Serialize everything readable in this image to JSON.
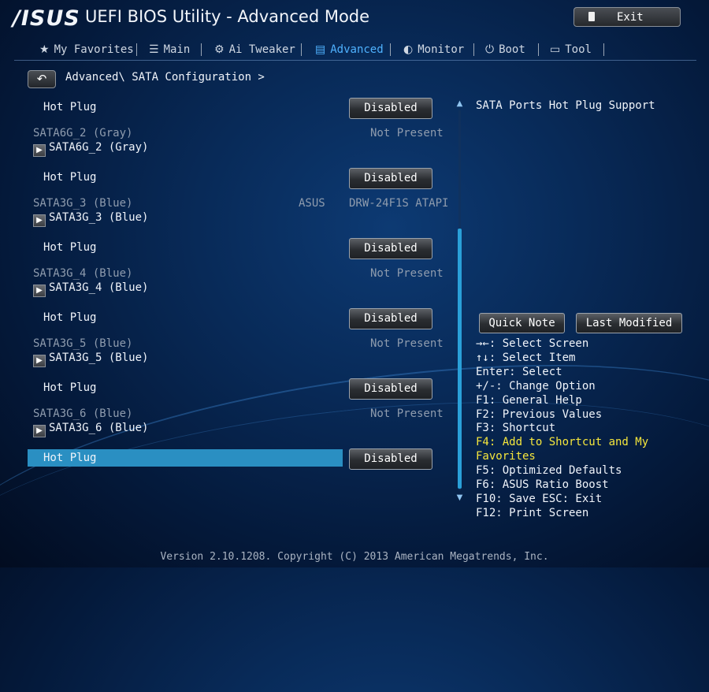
{
  "header": {
    "logo": "/ISUS",
    "title": "UEFI BIOS Utility - Advanced Mode",
    "exit_label": "Exit"
  },
  "nav": [
    {
      "label": "My Favorites",
      "icon": "star-icon"
    },
    {
      "label": "Main",
      "icon": "list-icon"
    },
    {
      "label": "Ai Tweaker",
      "icon": "tweaker-icon"
    },
    {
      "label": "Advanced",
      "icon": "advanced-icon",
      "active": true
    },
    {
      "label": "Monitor",
      "icon": "monitor-icon"
    },
    {
      "label": "Boot",
      "icon": "power-icon"
    },
    {
      "label": "Tool",
      "icon": "printer-icon"
    }
  ],
  "breadcrumb": "Advanced\\ SATA Configuration >",
  "items": {
    "hotplug_label": "Hot Plug",
    "disabled": "Disabled",
    "ports": [
      {
        "header": "SATA6G_2 (Gray)",
        "sub": "SATA6G_2 (Gray)",
        "status": "Not Present"
      },
      {
        "header": "SATA3G_3 (Blue)",
        "sub": "SATA3G_3 (Blue)",
        "vendor": "ASUS",
        "status": "DRW-24F1S ATAPI"
      },
      {
        "header": "SATA3G_4 (Blue)",
        "sub": "SATA3G_4 (Blue)",
        "status": "Not Present"
      },
      {
        "header": "SATA3G_5 (Blue)",
        "sub": "SATA3G_5 (Blue)",
        "status": "Not Present"
      },
      {
        "header": "SATA3G_6 (Blue)",
        "sub": "SATA3G_6 (Blue)",
        "status": "Not Present"
      }
    ]
  },
  "help_text": "SATA Ports Hot Plug Support",
  "buttons": {
    "quick_note": "Quick Note",
    "last_modified": "Last Modified"
  },
  "keys": [
    "→←: Select Screen",
    "↑↓: Select Item",
    "Enter: Select",
    "+/-: Change Option",
    "F1: General Help",
    "F2: Previous Values",
    "F3: Shortcut",
    "F4: Add to Shortcut and My Favorites",
    "F5: Optimized Defaults",
    "F6: ASUS Ratio Boost",
    "F10: Save  ESC: Exit",
    "F12: Print Screen"
  ],
  "footer": "Version 2.10.1208. Copyright (C) 2013 American Megatrends, Inc.",
  "colors": {
    "accent": "#4fb2ff",
    "selected_row": "#2a8fc2",
    "highlight_key": "#f5e63c"
  }
}
